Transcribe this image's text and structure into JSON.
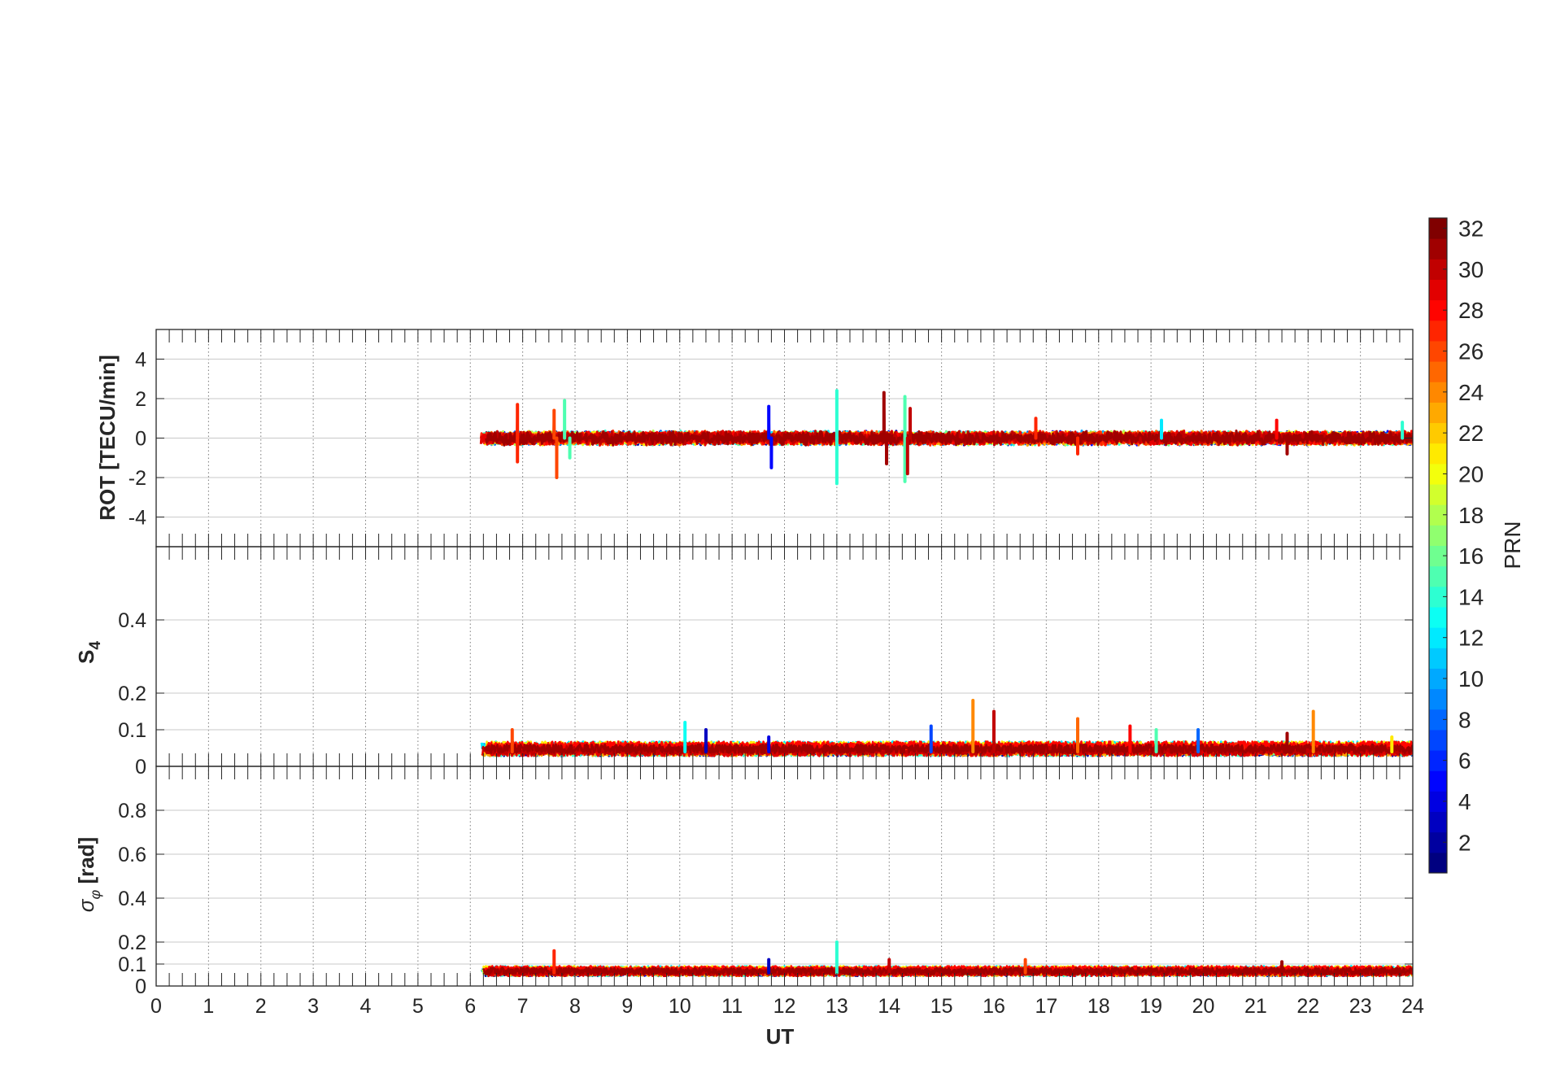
{
  "chart_data": [
    {
      "type": "line",
      "panel": "ROT",
      "ylabel": "ROT [TECU/min]",
      "xlabel": "",
      "xlim": [
        0,
        24
      ],
      "ylim": [
        -5.5,
        5.5
      ],
      "yticks": [
        -4,
        -2,
        0,
        2,
        4
      ],
      "grid": true,
      "data_start_ut": 6.2,
      "data_end_ut": 24,
      "baseline": 0,
      "typical_noise": 0.25,
      "spikes": [
        {
          "x": 6.9,
          "y": 1.7,
          "prn": 27
        },
        {
          "x": 6.9,
          "y": -1.2,
          "prn": 27
        },
        {
          "x": 7.6,
          "y": 1.4,
          "prn": 26
        },
        {
          "x": 7.65,
          "y": -2.0,
          "prn": 26
        },
        {
          "x": 7.8,
          "y": 1.9,
          "prn": 15
        },
        {
          "x": 7.9,
          "y": -1.0,
          "prn": 15
        },
        {
          "x": 11.7,
          "y": 1.6,
          "prn": 5
        },
        {
          "x": 11.75,
          "y": -1.5,
          "prn": 5
        },
        {
          "x": 13.0,
          "y": 2.4,
          "prn": 14
        },
        {
          "x": 13.0,
          "y": -2.3,
          "prn": 14
        },
        {
          "x": 13.9,
          "y": 2.3,
          "prn": 31
        },
        {
          "x": 13.95,
          "y": -1.3,
          "prn": 31
        },
        {
          "x": 14.3,
          "y": 2.1,
          "prn": 15
        },
        {
          "x": 14.3,
          "y": -2.2,
          "prn": 15
        },
        {
          "x": 14.4,
          "y": 1.5,
          "prn": 30
        },
        {
          "x": 14.35,
          "y": -1.8,
          "prn": 30
        },
        {
          "x": 16.8,
          "y": 1.0,
          "prn": 27
        },
        {
          "x": 17.6,
          "y": -0.8,
          "prn": 27
        },
        {
          "x": 19.2,
          "y": 0.9,
          "prn": 12
        },
        {
          "x": 21.4,
          "y": 0.9,
          "prn": 28
        },
        {
          "x": 21.6,
          "y": -0.8,
          "prn": 31
        },
        {
          "x": 23.8,
          "y": 0.8,
          "prn": 14
        }
      ]
    },
    {
      "type": "line",
      "panel": "S4",
      "ylabel": "S4",
      "xlabel": "",
      "xlim": [
        0,
        24
      ],
      "ylim": [
        0,
        0.6
      ],
      "yticks": [
        0,
        0.1,
        0.2,
        0.4
      ],
      "ytick_labels": [
        "0",
        "0.1",
        "0.2",
        "0.4"
      ],
      "grid": true,
      "data_start_ut": 6.2,
      "data_end_ut": 24,
      "baseline": 0.04,
      "typical_noise": 0.012,
      "spikes": [
        {
          "x": 6.8,
          "y": 0.1,
          "prn": 26
        },
        {
          "x": 10.1,
          "y": 0.12,
          "prn": 13
        },
        {
          "x": 10.5,
          "y": 0.1,
          "prn": 3
        },
        {
          "x": 11.7,
          "y": 0.08,
          "prn": 4
        },
        {
          "x": 14.8,
          "y": 0.11,
          "prn": 7
        },
        {
          "x": 15.6,
          "y": 0.18,
          "prn": 24
        },
        {
          "x": 16.0,
          "y": 0.15,
          "prn": 30
        },
        {
          "x": 17.6,
          "y": 0.13,
          "prn": 25
        },
        {
          "x": 18.6,
          "y": 0.11,
          "prn": 28
        },
        {
          "x": 19.1,
          "y": 0.1,
          "prn": 15
        },
        {
          "x": 19.9,
          "y": 0.1,
          "prn": 8
        },
        {
          "x": 21.6,
          "y": 0.09,
          "prn": 31
        },
        {
          "x": 22.1,
          "y": 0.15,
          "prn": 24
        },
        {
          "x": 23.6,
          "y": 0.08,
          "prn": 21
        }
      ]
    },
    {
      "type": "line",
      "panel": "sigma_phi",
      "ylabel": "σφ [rad]",
      "xlabel": "UT",
      "xlim": [
        0,
        24
      ],
      "ylim": [
        0,
        1.0
      ],
      "yticks": [
        0,
        0.1,
        0.2,
        0.4,
        0.6,
        0.8
      ],
      "ytick_labels": [
        "0",
        "0.1",
        "0.2",
        "0.4",
        "0.6",
        "0.8"
      ],
      "xticks": [
        0,
        1,
        2,
        3,
        4,
        5,
        6,
        7,
        8,
        9,
        10,
        11,
        12,
        13,
        14,
        15,
        16,
        17,
        18,
        19,
        20,
        21,
        22,
        23,
        24
      ],
      "grid": true,
      "data_start_ut": 6.2,
      "data_end_ut": 24,
      "baseline": 0.06,
      "typical_noise": 0.015,
      "spikes": [
        {
          "x": 7.6,
          "y": 0.16,
          "prn": 27
        },
        {
          "x": 11.7,
          "y": 0.12,
          "prn": 3
        },
        {
          "x": 13.0,
          "y": 0.2,
          "prn": 14
        },
        {
          "x": 14.0,
          "y": 0.12,
          "prn": 30
        },
        {
          "x": 16.6,
          "y": 0.12,
          "prn": 26
        },
        {
          "x": 21.5,
          "y": 0.11,
          "prn": 31
        }
      ]
    }
  ],
  "colorbar": {
    "label": "PRN",
    "min": 1,
    "max": 32,
    "ticks": [
      2,
      4,
      6,
      8,
      10,
      12,
      14,
      16,
      18,
      20,
      22,
      24,
      26,
      28,
      30,
      32
    ],
    "colormap": "jet"
  },
  "colors": {
    "axes": "#262626",
    "grid": "#c8c8c8"
  }
}
